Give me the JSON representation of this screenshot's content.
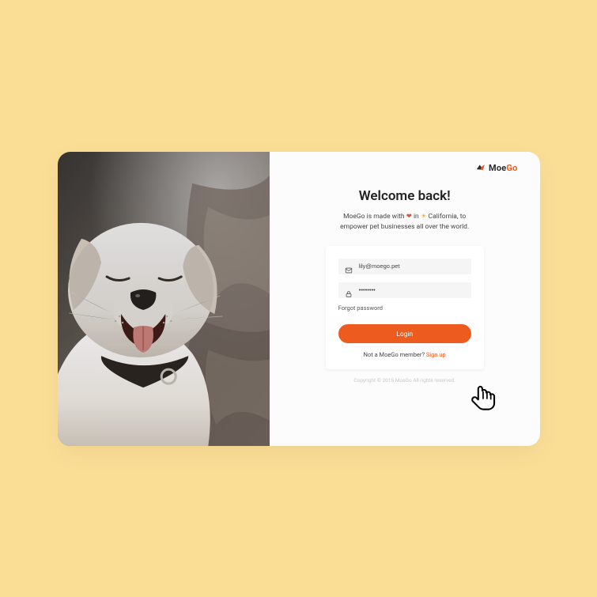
{
  "brand": {
    "name_a": "Moe",
    "name_b": "Go"
  },
  "welcome": "Welcome back!",
  "subtext": {
    "p1": "MoeGo is made with ",
    "heart": "❤",
    "p2": " in ",
    "sun": "☀",
    "p3": " California, to",
    "p4": "empower pet businesses all over the world."
  },
  "form": {
    "email_value": "lily@moego.pet",
    "password_value": "••••••••",
    "forgot": "Forgot password",
    "login": "Login",
    "not_member": "Not a MoeGo member? ",
    "signup": "Sign up"
  },
  "copyright": "Copyright © 2015 MoeGo All rights reserved.",
  "colors": {
    "accent": "#ed5b1e",
    "bg": "#fbde96"
  }
}
